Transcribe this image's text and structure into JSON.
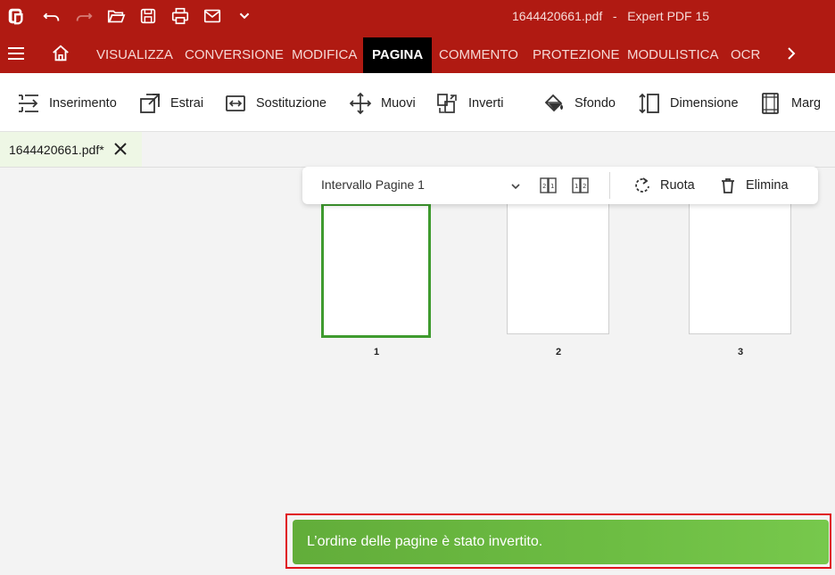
{
  "titlebar": {
    "title": "1644420661.pdf   -   Expert PDF 15"
  },
  "menu": {
    "tabs": [
      {
        "label": "VISUALIZZA"
      },
      {
        "label": "CONVERSIONE"
      },
      {
        "label": "MODIFICA"
      },
      {
        "label": "PAGINA"
      },
      {
        "label": "COMMENTO"
      },
      {
        "label": "PROTEZIONE"
      },
      {
        "label": "MODULISTICA"
      },
      {
        "label": "OCR"
      }
    ],
    "active_tab": "PAGINA"
  },
  "ribbon": {
    "buttons": [
      {
        "label": "Inserimento",
        "icon": "insert-icon"
      },
      {
        "label": "Estrai",
        "icon": "extract-icon"
      },
      {
        "label": "Sostituzione",
        "icon": "replace-icon"
      },
      {
        "label": "Muovi",
        "icon": "move-icon"
      },
      {
        "label": "Inverti",
        "icon": "invert-icon"
      },
      {
        "label": "Sfondo",
        "icon": "fill-bucket-icon"
      },
      {
        "label": "Dimensione",
        "icon": "resize-icon"
      },
      {
        "label": "Marg",
        "icon": "margins-icon"
      }
    ]
  },
  "document_tab": {
    "name": "1644420661.pdf*"
  },
  "page_toolbar": {
    "range_label": "Intervallo Pagine 1",
    "rotate_label": "Ruota",
    "delete_label": "Elimina"
  },
  "pages": [
    {
      "number": "1",
      "selected": true
    },
    {
      "number": "2",
      "selected": false
    },
    {
      "number": "3",
      "selected": false
    }
  ],
  "toast": {
    "message": "L’ordine delle pagine è stato invertito."
  },
  "colors": {
    "brand": "#b01a12",
    "selection": "#3f9b2f",
    "toast": "#6dbd43",
    "highlight": "#e0121b"
  }
}
